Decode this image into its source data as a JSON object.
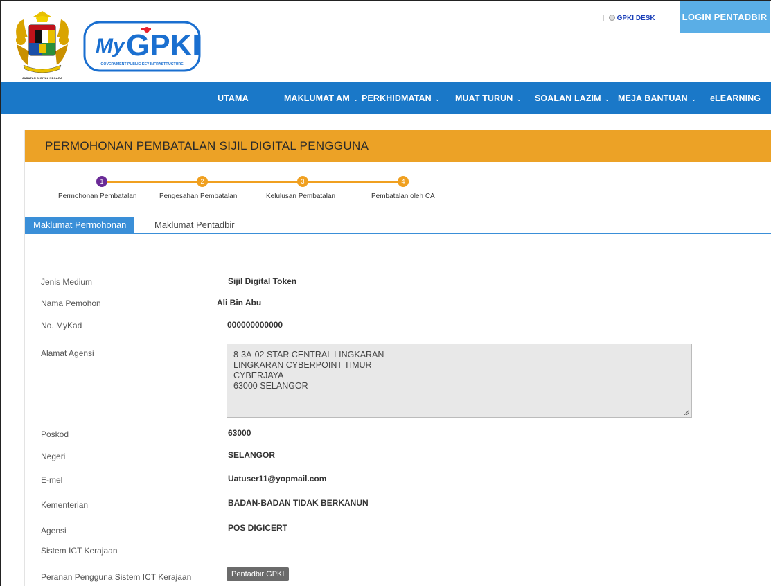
{
  "header": {
    "crest_caption": "JABATAN DIGITAL NEGARA",
    "logo_text": "MyGPKI",
    "logo_subtitle": "GOVERNMENT PUBLIC KEY INFRASTRUCTURE",
    "desk_link": "GPKI DESK",
    "login_button": "LOGIN PENTADBIR"
  },
  "nav": {
    "items": [
      {
        "label": "UTAMA",
        "dropdown": false
      },
      {
        "label": "MAKLUMAT AM",
        "dropdown": true
      },
      {
        "label": "PERKHIDMATAN",
        "dropdown": true
      },
      {
        "label": "MUAT TURUN",
        "dropdown": true
      },
      {
        "label": "SOALAN LAZIM",
        "dropdown": true
      },
      {
        "label": "MEJA BANTUAN",
        "dropdown": true
      },
      {
        "label": "eLEARNING",
        "dropdown": false
      }
    ]
  },
  "panel": {
    "title": "PERMOHONAN PEMBATALAN SIJIL DIGITAL PENGGUNA"
  },
  "stepper": {
    "current_step": 1,
    "steps": [
      {
        "number": "1",
        "label": "Permohonan Pembatalan"
      },
      {
        "number": "2",
        "label": "Pengesahan Pembatalan"
      },
      {
        "number": "3",
        "label": "Kelulusan Pembatalan"
      },
      {
        "number": "4",
        "label": "Pembatalan oleh CA"
      }
    ]
  },
  "tabs": [
    {
      "label": "Maklumat Permohonan",
      "active": true
    },
    {
      "label": "Maklumat Pentadbir",
      "active": false
    }
  ],
  "form": {
    "jenis_medium": {
      "label": "Jenis Medium",
      "value": "Sijil Digital Token"
    },
    "nama_pemohon": {
      "label": "Nama Pemohon",
      "value": "Ali Bin Abu"
    },
    "no_mykad": {
      "label": "No. MyKad",
      "value": "000000000000"
    },
    "alamat_agensi": {
      "label": "Alamat Agensi",
      "lines": [
        "8-3A-02 STAR CENTRAL LINGKARAN",
        "LINGKARAN CYBERPOINT TIMUR",
        "CYBERJAYA",
        "63000 SELANGOR"
      ]
    },
    "poskod": {
      "label": "Poskod",
      "value": "63000"
    },
    "negeri": {
      "label": "Negeri",
      "value": "SELANGOR"
    },
    "emel": {
      "label": "E-mel",
      "value": "Uatuser11@yopmail.com"
    },
    "kementerian": {
      "label": "Kementerian",
      "value": "BADAN-BADAN TIDAK BERKANUN"
    },
    "agensi": {
      "label": "Agensi",
      "value": "POS DIGICERT"
    },
    "sistem_ict": {
      "label": "Sistem ICT Kerajaan",
      "value": ""
    },
    "peranan": {
      "label": "Peranan Pengguna Sistem ICT Kerajaan",
      "value": "Pentadbir GPKI"
    }
  },
  "colors": {
    "nav_bg": "#1a78c8",
    "panel_header": "#eca226",
    "step_active": "#6a2a96",
    "step_inactive": "#f0a020",
    "tab_active": "#3a8fd8",
    "login_bg": "#5aaee6"
  }
}
